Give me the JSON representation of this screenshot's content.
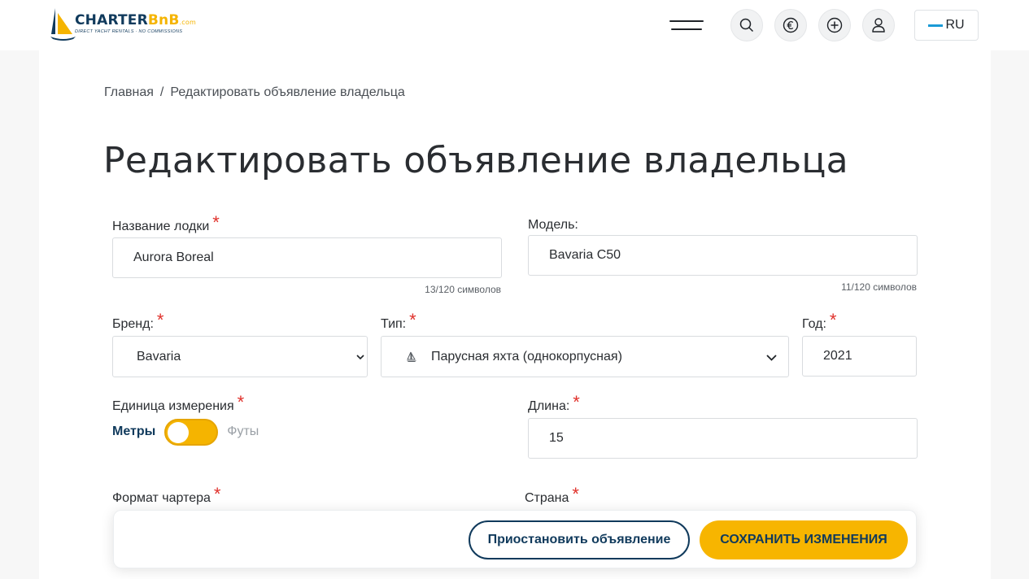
{
  "header": {
    "logo": {
      "brand_main": "CHARTER",
      "brand_accent": "BnB",
      "brand_tld": ".com",
      "tagline": "DIRECT YACHT RENTALS · NO COMMISSIONS"
    },
    "language": "RU",
    "icons": [
      "menu-icon",
      "search-icon",
      "euro-icon",
      "plus-circle-icon",
      "user-icon"
    ]
  },
  "breadcrumb": {
    "home": "Главная",
    "separator": "/",
    "current": "Редактировать объявление владельца"
  },
  "page_title": "Редактировать объявление владельца",
  "form": {
    "required_mark": "*",
    "boat_name": {
      "label": "Название лодки",
      "value": "Aurora Boreal",
      "counter": "13/120 символов"
    },
    "model": {
      "label": "Модель:",
      "value": "Bavaria C50",
      "counter": "11/120 символов"
    },
    "brand": {
      "label": "Бренд:",
      "value": "Bavaria"
    },
    "type": {
      "label": "Тип:",
      "value": "Парусная яхта (однокорпусная)"
    },
    "year": {
      "label": "Год:",
      "value": "2021"
    },
    "unit": {
      "label": "Единица измерения",
      "option_on": "Метры",
      "option_off": "Футы"
    },
    "length": {
      "label": "Длина:",
      "value": "15"
    },
    "charter_format": {
      "label": "Формат чартера"
    },
    "country": {
      "label": "Страна"
    }
  },
  "actions": {
    "suspend": "Приостановить объявление",
    "save": "СОХРАНИТЬ ИЗМЕНЕНИЯ"
  },
  "colors": {
    "accent": "#f5b400",
    "brand_navy": "#103a5c",
    "required": "#e0312b"
  }
}
